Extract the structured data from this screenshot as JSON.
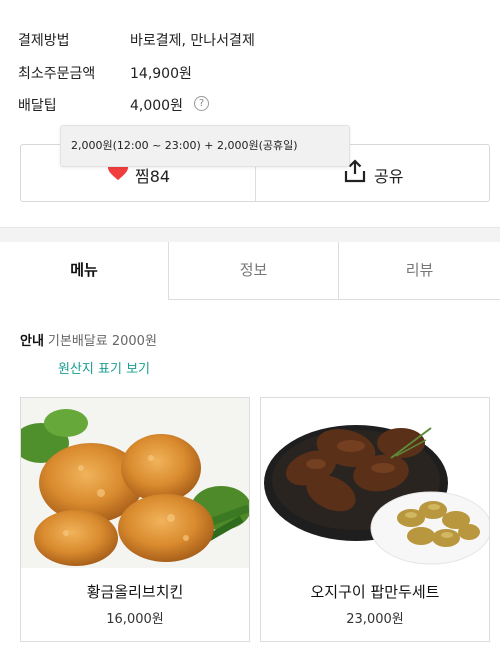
{
  "store_info": {
    "payment_label": "결제방법",
    "payment_value": "바로결제, 만나서결제",
    "min_order_label": "최소주문금액",
    "min_order_value": "14,900원",
    "delivery_tip_label": "배달팁",
    "delivery_tip_value": "4,000원",
    "help_icon": "question-circle-icon"
  },
  "tooltip": {
    "text": "2,000원(12:00 ~ 23:00) + 2,000원(공휴일)"
  },
  "actions": {
    "like_label": "찜84",
    "share_label": "공유",
    "heart_color": "#f03e3e"
  },
  "tabs": [
    {
      "label": "메뉴"
    },
    {
      "label": "정보"
    },
    {
      "label": "리뷰"
    }
  ],
  "notice": {
    "label": "안내",
    "text": "기본배달료 2000원",
    "origin_link": "원산지 표기 보기"
  },
  "menu_items": [
    {
      "name": "황금올리브치킨",
      "price": "16,000원"
    },
    {
      "name": "오지구이 팝만두세트",
      "price": "23,000원"
    }
  ],
  "colors": {
    "accent_teal": "#1a9e8f",
    "like_red": "#f03e3e"
  }
}
